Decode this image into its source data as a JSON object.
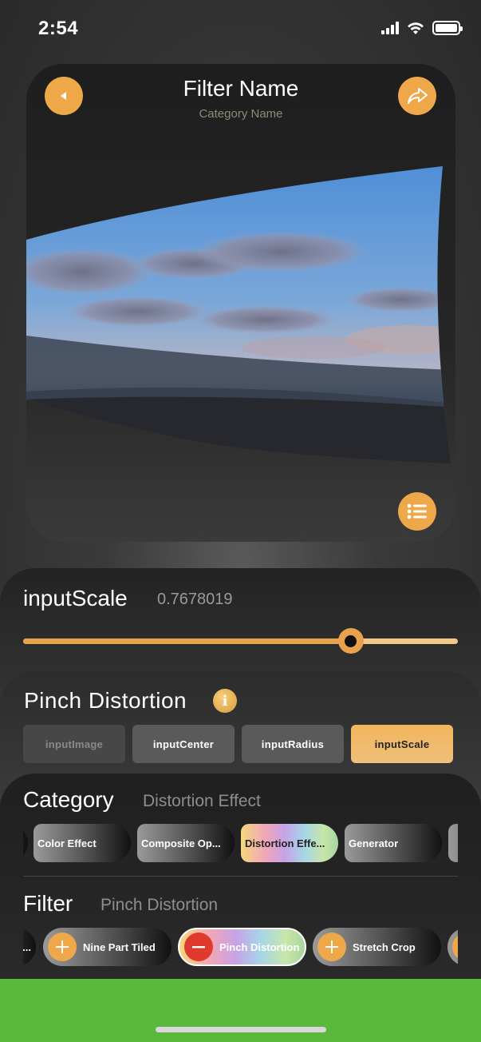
{
  "status_bar": {
    "time": "2:54"
  },
  "header": {
    "filter_name": "Filter Name",
    "category_name": "Category Name"
  },
  "parameter": {
    "name": "inputScale",
    "value": "0.7678019",
    "slider_fraction": 0.754
  },
  "filter_info": {
    "title": "Pinch Distortion",
    "info_glyph": "i",
    "tabs": [
      {
        "label": "inputImage",
        "state": "disabled"
      },
      {
        "label": "inputCenter",
        "state": "normal"
      },
      {
        "label": "inputRadius",
        "state": "normal"
      },
      {
        "label": "inputScale",
        "state": "active"
      }
    ]
  },
  "category": {
    "label": "Category",
    "selected": "Distortion Effect",
    "chips": [
      "Color Effect",
      "Composite Op...",
      "Distortion Effe...",
      "Generator"
    ]
  },
  "filter": {
    "label": "Filter",
    "selected": "Pinch Distortion",
    "chips": [
      "...",
      "Nine Part Tiled",
      "Pinch Distortion",
      "Stretch Crop"
    ]
  },
  "colors": {
    "accent": "#eea84a",
    "remove": "#e03a2e",
    "bottom_bar": "#5ab83c"
  },
  "icons": {
    "back": "triangle-left-icon",
    "share": "share-arrow-icon",
    "list": "list-icon",
    "info": "info-icon",
    "add": "plus-icon",
    "remove": "minus-icon"
  }
}
